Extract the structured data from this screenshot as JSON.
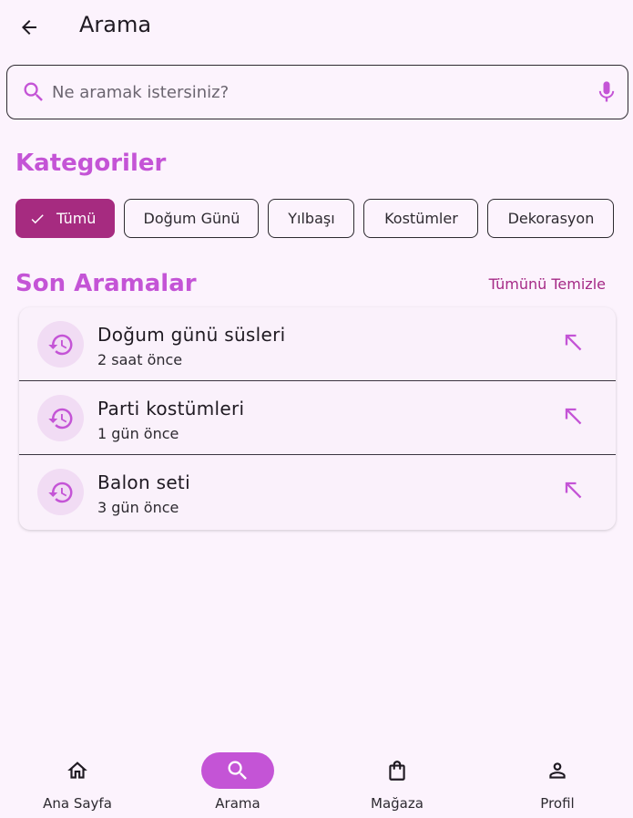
{
  "header": {
    "title": "Arama"
  },
  "search": {
    "placeholder": "Ne aramak istersiniz?",
    "value": ""
  },
  "categories": {
    "title": "Kategoriler",
    "chips": [
      {
        "label": "Tümü",
        "selected": true
      },
      {
        "label": "Doğum Günü",
        "selected": false
      },
      {
        "label": "Yılbaşı",
        "selected": false
      },
      {
        "label": "Kostümler",
        "selected": false
      },
      {
        "label": "Dekorasyon",
        "selected": false
      }
    ]
  },
  "recent": {
    "title": "Son Aramalar",
    "clear_label": "Tümünü Temizle",
    "items": [
      {
        "title": "Doğum günü süsleri",
        "time": "2 saat önce"
      },
      {
        "title": "Parti kostümleri",
        "time": "1 gün önce"
      },
      {
        "title": "Balon seti",
        "time": "3 gün önce"
      }
    ]
  },
  "nav": {
    "items": [
      {
        "label": "Ana Sayfa",
        "icon": "home-icon",
        "active": false
      },
      {
        "label": "Arama",
        "icon": "search-icon",
        "active": true
      },
      {
        "label": "Mağaza",
        "icon": "shopping-bag-icon",
        "active": false
      },
      {
        "label": "Profil",
        "icon": "person-icon",
        "active": false
      }
    ]
  },
  "colors": {
    "accent": "#c454d6",
    "chip_selected": "#a62b80",
    "background": "#fcf3fd",
    "icon_circle": "#f1dcf4"
  }
}
